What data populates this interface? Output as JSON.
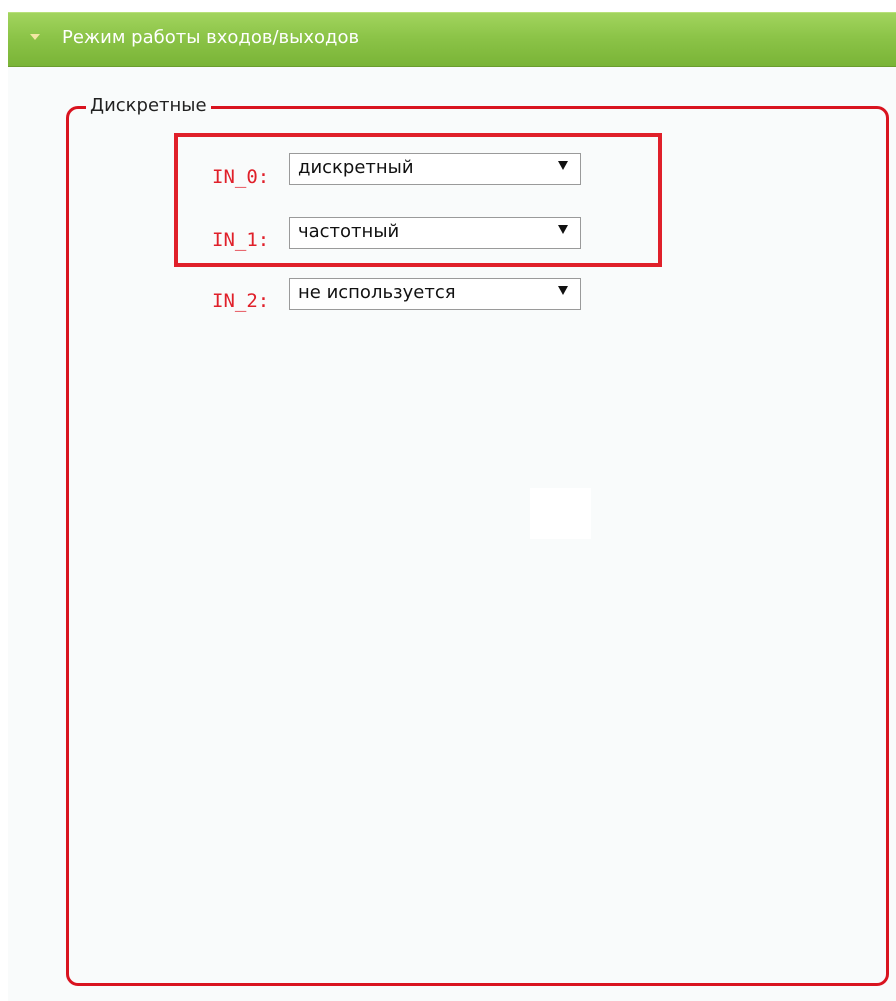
{
  "section": {
    "title": "Режим работы входов/выходов",
    "collapse_icon": "triangle-down-icon",
    "accent_color": "#8cc448"
  },
  "group": {
    "legend": "Дискретные",
    "border_color": "#d9131f",
    "inputs": [
      {
        "label": "IN_0:",
        "value": "дискретный"
      },
      {
        "label": "IN_1:",
        "value": "частотный"
      },
      {
        "label": "IN_2:",
        "value": "не используется"
      }
    ]
  },
  "highlight_color": "#e0202a"
}
